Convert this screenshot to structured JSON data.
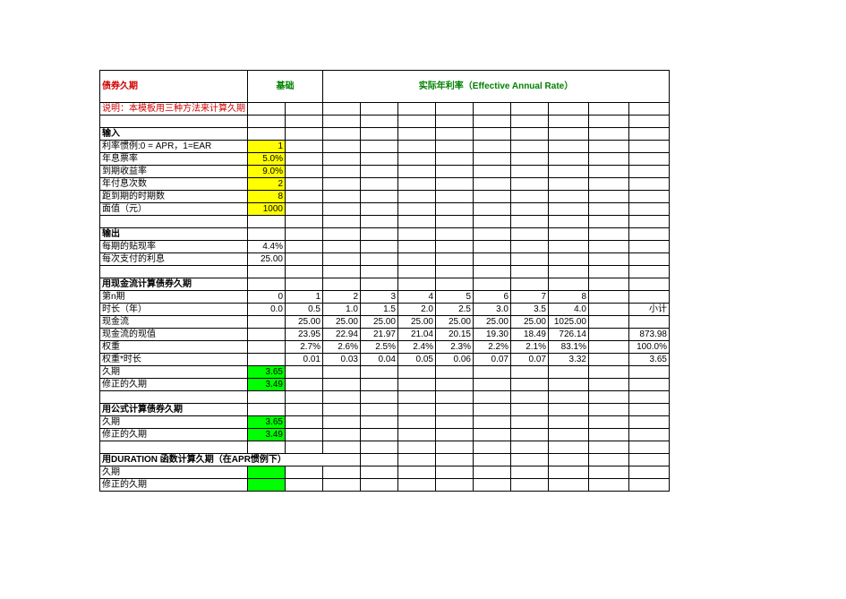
{
  "header": {
    "title": "债券久期",
    "basis": "基础",
    "ear": "实际年利率（Effective Annual Rate）",
    "note": "说明：本模板用三种方法来计算久期"
  },
  "sections": {
    "inputs": "输入",
    "outputs": "输出",
    "cashflow": "用现金流计算债券久期",
    "formula": "用公式计算债券久期",
    "duration_fn": "用DURATION 函数计算久期（在APR惯例下）"
  },
  "inputs": {
    "rate_convention_label": "利率惯例:0 = APR，1=EAR",
    "rate_convention_value": "1",
    "coupon_label": "年息票率",
    "coupon_value": "5.0%",
    "ytm_label": "到期收益率",
    "ytm_value": "9.0%",
    "freq_label": "年付息次数",
    "freq_value": "2",
    "periods_label": "距到期的时期数",
    "periods_value": "8",
    "face_label": "面值（元）",
    "face_value": "1000"
  },
  "outputs": {
    "disc_label": "每期的贴现率",
    "disc_value": "4.4%",
    "coupon_pmt_label": "每次支付的利息",
    "coupon_pmt_value": "25.00"
  },
  "cashflow_table": {
    "period_label": "第n期",
    "time_label": "时长（年）",
    "cf_label": "现金流",
    "pv_label": "现金流的现值",
    "weight_label": "权重",
    "wt_label": "权重*时长",
    "subtotal": "小计",
    "periods": [
      "0",
      "1",
      "2",
      "3",
      "4",
      "5",
      "6",
      "7",
      "8"
    ],
    "times": [
      "0.0",
      "0.5",
      "1.0",
      "1.5",
      "2.0",
      "2.5",
      "3.0",
      "3.5",
      "4.0"
    ],
    "cfs": [
      "",
      "25.00",
      "25.00",
      "25.00",
      "25.00",
      "25.00",
      "25.00",
      "25.00",
      "1025.00"
    ],
    "pvs": [
      "",
      "23.95",
      "22.94",
      "21.97",
      "21.04",
      "20.15",
      "19.30",
      "18.49",
      "726.14"
    ],
    "pv_total": "873.98",
    "weights": [
      "",
      "2.7%",
      "2.6%",
      "2.5%",
      "2.4%",
      "2.3%",
      "2.2%",
      "2.1%",
      "83.1%"
    ],
    "weights_total": "100.0%",
    "wtimes": [
      "",
      "0.01",
      "0.03",
      "0.04",
      "0.05",
      "0.06",
      "0.07",
      "0.07",
      "3.32"
    ],
    "wtimes_total": "3.65",
    "duration_label": "久期",
    "duration_value": "3.65",
    "mod_duration_label": "修正的久期",
    "mod_duration_value": "3.49"
  },
  "formula_calc": {
    "duration_label": "久期",
    "duration_value": "3.65",
    "mod_duration_label": "修正的久期",
    "mod_duration_value": "3.49"
  },
  "duration_fn_calc": {
    "duration_label": "久期",
    "mod_duration_label": "修正的久期"
  },
  "chart_data": {
    "type": "table",
    "title": "债券久期",
    "inputs": {
      "rate_convention": 1,
      "annual_coupon_rate": 0.05,
      "yield_to_maturity": 0.09,
      "payments_per_year": 2,
      "periods_to_maturity": 8,
      "face_value": 1000
    },
    "outputs": {
      "periodic_discount_rate": 0.044,
      "coupon_payment": 25.0
    },
    "cashflow": {
      "period": [
        0,
        1,
        2,
        3,
        4,
        5,
        6,
        7,
        8
      ],
      "time_years": [
        0.0,
        0.5,
        1.0,
        1.5,
        2.0,
        2.5,
        3.0,
        3.5,
        4.0
      ],
      "cash_flow": [
        null,
        25.0,
        25.0,
        25.0,
        25.0,
        25.0,
        25.0,
        25.0,
        1025.0
      ],
      "present_value": [
        null,
        23.95,
        22.94,
        21.97,
        21.04,
        20.15,
        19.3,
        18.49,
        726.14
      ],
      "present_value_total": 873.98,
      "weight_pct": [
        null,
        2.7,
        2.6,
        2.5,
        2.4,
        2.3,
        2.2,
        2.1,
        83.1
      ],
      "weight_total_pct": 100.0,
      "weight_times_time": [
        null,
        0.01,
        0.03,
        0.04,
        0.05,
        0.06,
        0.07,
        0.07,
        3.32
      ],
      "weight_times_time_total": 3.65
    },
    "duration_results": {
      "cashflow_method": {
        "duration": 3.65,
        "modified_duration": 3.49
      },
      "formula_method": {
        "duration": 3.65,
        "modified_duration": 3.49
      },
      "duration_function": {
        "duration": null,
        "modified_duration": null
      }
    }
  }
}
